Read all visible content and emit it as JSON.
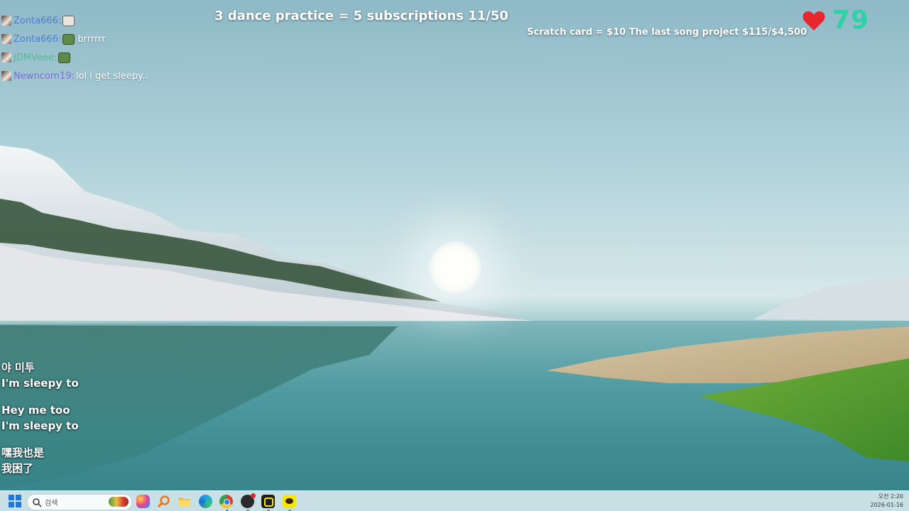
{
  "overlay": {
    "chat": [
      {
        "user": "Zonta666",
        "emote": "cat-emote",
        "message": ""
      },
      {
        "user": "Zonta666",
        "emote": "frog-emote",
        "message": "brrrrrr"
      },
      {
        "user": "JDMVeee",
        "emote": "frog-emote",
        "message": ""
      },
      {
        "user": "Newncorn19",
        "emote": "",
        "message": "lol i get sleepy.."
      }
    ],
    "goal_top": "3 dance practice = 5 subscriptions 11/50",
    "goal_right": "Scratch card = $10 The last song project $115/$4,500",
    "heart_count": "79",
    "heart_color": "#e8262e",
    "count_color": "#2fd1a6",
    "subtitles": [
      [
        "야 미투",
        "I'm sleepy to"
      ],
      [
        "Hey me too",
        "I'm sleepy to"
      ],
      [
        "嘿我也是",
        "我困了"
      ]
    ]
  },
  "taskbar": {
    "search_placeholder": "검색",
    "apps": [
      "copilot-icon",
      "search-app-icon",
      "file-explorer-icon",
      "edge-icon",
      "chrome-icon",
      "obs-icon",
      "kakao-app-icon",
      "kakaotalk-icon"
    ],
    "time": "오전 2:20",
    "date": "2026-01-16"
  }
}
